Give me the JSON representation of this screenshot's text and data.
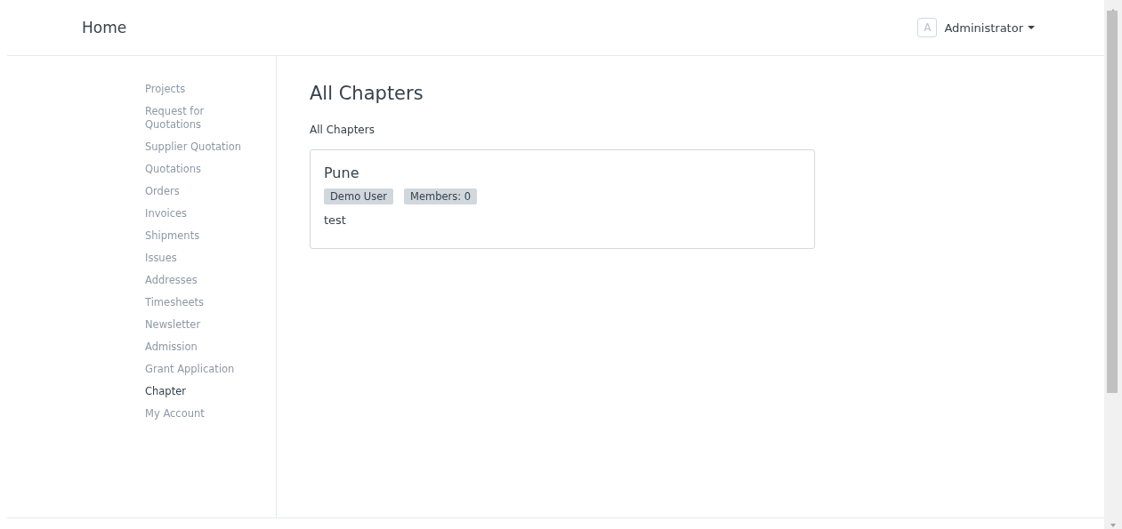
{
  "navbar": {
    "brand": "Home",
    "user": {
      "avatar_letter": "A",
      "name": "Administrator"
    }
  },
  "sidebar": {
    "items": [
      {
        "label": "Projects",
        "selected": false
      },
      {
        "label": "Request for Quotations",
        "selected": false
      },
      {
        "label": "Supplier Quotation",
        "selected": false
      },
      {
        "label": "Quotations",
        "selected": false
      },
      {
        "label": "Orders",
        "selected": false
      },
      {
        "label": "Invoices",
        "selected": false
      },
      {
        "label": "Shipments",
        "selected": false
      },
      {
        "label": "Issues",
        "selected": false
      },
      {
        "label": "Addresses",
        "selected": false
      },
      {
        "label": "Timesheets",
        "selected": false
      },
      {
        "label": "Newsletter",
        "selected": false
      },
      {
        "label": "Admission",
        "selected": false
      },
      {
        "label": "Grant Application",
        "selected": false
      },
      {
        "label": "Chapter",
        "selected": true
      },
      {
        "label": "My Account",
        "selected": false
      }
    ]
  },
  "content": {
    "title": "All Chapters",
    "subtitle": "All Chapters",
    "cards": [
      {
        "title": "Pune",
        "badges": [
          "Demo User",
          "Members: 0"
        ],
        "text": "test"
      }
    ]
  }
}
